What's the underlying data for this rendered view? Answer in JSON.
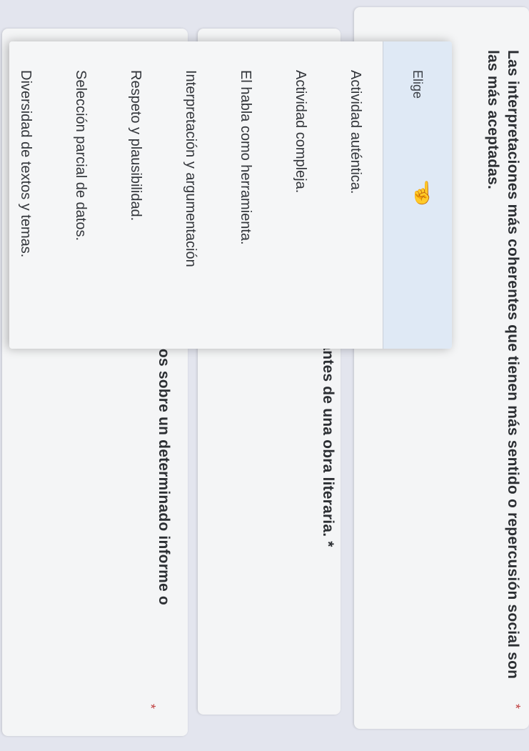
{
  "questions": {
    "q1": {
      "text": "Las interpretaciones más coherentes que tienen más sentido o repercusión social son las más aceptadas.",
      "required": "*"
    },
    "q2": {
      "text": "rantes de una obra literaria. *"
    },
    "q3": {
      "text": "ivos sobre un determinado informe o",
      "required": "*"
    }
  },
  "dropdown": {
    "placeholder": "Elige",
    "pointer_icon": "hand-pointer-icon",
    "options": [
      "Actividad auténtica.",
      "Actividad compleja.",
      "El habla como herramienta.",
      "Interpretación y argumentación",
      "Respeto y plausibilidad.",
      "Selección parcial de datos.",
      "Diversidad de textos y temas."
    ]
  }
}
